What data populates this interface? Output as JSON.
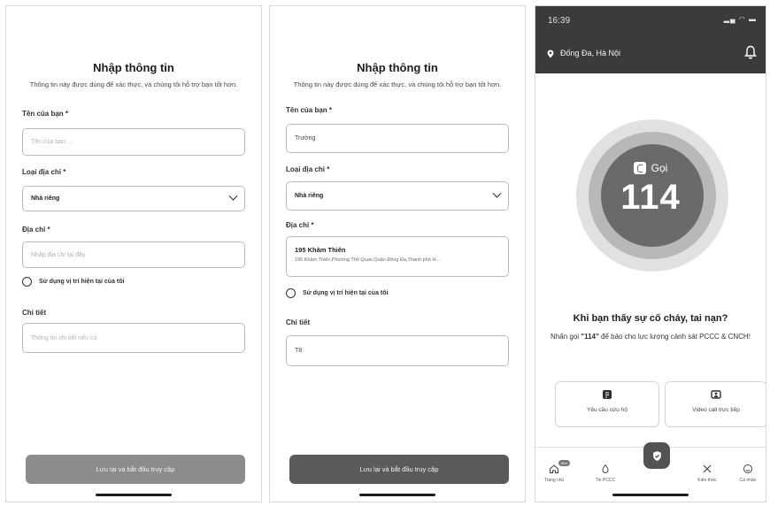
{
  "screen1": {
    "title": "Nhập thông tin",
    "subtitle": "Thông tin này được dùng để xác thực, và chúng tôi hỗ trợ bạn tốt hơn.",
    "name_label": "Tên của bạn *",
    "name_placeholder": "Tên của bạn ...",
    "address_type_label": "Loại địa chỉ *",
    "address_type_value": "Nhà riêng",
    "address_label": "Địa chỉ *",
    "address_placeholder": "Nhập địa chỉ tại đây",
    "use_location_label": "Sử dụng vị trí hiện tại của tôi",
    "detail_label": "Chi tiết",
    "detail_placeholder": "Thông tin chi tiết nếu có",
    "submit_label": "Lưu lại và bắt đầu truy cập"
  },
  "screen2": {
    "title": "Nhập thông tin",
    "subtitle": "Thông tin này được dùng để xác thực, và chúng tôi hỗ trợ bạn tốt hơn.",
    "name_label": "Tên của bạn *",
    "name_value": "Trường",
    "address_type_label": "Loại địa chỉ *",
    "address_type_value": "Nhà riêng",
    "address_label": "Địa chỉ *",
    "address_value": "195 Khâm Thiên",
    "address_detail": "195 Khâm Thiên,Phường Thổ Quan,Quận Đống Đa,Thành phố H...",
    "use_location_label": "Sử dụng vị trí hiện tại của tôi",
    "detail_label": "Chi tiết",
    "detail_value": "T8",
    "submit_label": "Lưu lại và bắt đầu truy cập"
  },
  "screen3": {
    "time": "16:39",
    "status_icons": "▂▄ ◠ ▬",
    "location": "Đống Đa, Hà Nội",
    "call_label": "Gọi",
    "call_number": "114",
    "heading": "Khi bạn thấy sự cố cháy, tai nạn?",
    "description_prefix": "Nhấn gọi ",
    "description_number": "\"114\"",
    "description_suffix": " để báo cho lực lượng cảnh sát PCCC & CNCH!",
    "card_rescue": "Yêu cầu cứu hộ",
    "card_video": "Video call trực tiếp",
    "tabs": [
      "Trang chủ",
      "Tin PCCC",
      "Tôi an toàn",
      "Kiến thức",
      "Cá nhân"
    ],
    "tab_badge": "Mới"
  },
  "icons": [
    "chevron-down-icon",
    "radio-icon",
    "location-pin-icon",
    "bell-icon",
    "phone-icon",
    "rescue-icon",
    "video-call-icon",
    "home-icon",
    "news-icon",
    "shield-icon",
    "tools-icon",
    "profile-icon"
  ]
}
